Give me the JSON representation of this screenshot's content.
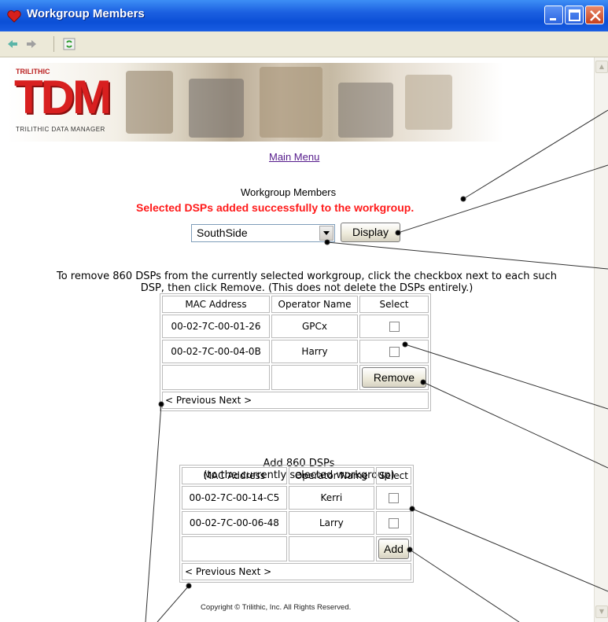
{
  "window": {
    "title": "Workgroup Members"
  },
  "logo": {
    "brand": "TRILITHIC",
    "name": "TDM",
    "subtitle": "TRILITHIC DATA MANAGER"
  },
  "nav": {
    "main_menu": "Main Menu"
  },
  "page": {
    "heading": "Workgroup Members",
    "success_message": "Selected DSPs added successfully to the workgroup."
  },
  "workgroup_select": {
    "value": "SouthSide"
  },
  "buttons": {
    "display": "Display",
    "remove": "Remove",
    "add": "Add"
  },
  "remove_section": {
    "instruction_line1": "To remove 860 DSPs from the currently selected workgroup, click the checkbox next to each such",
    "instruction_line2": "DSP, then click Remove. (This does not delete the DSPs entirely.)",
    "headers": [
      "MAC Address",
      "Operator Name",
      "Select"
    ],
    "rows": [
      {
        "mac": "00-02-7C-00-01-26",
        "operator": "GPCx"
      },
      {
        "mac": "00-02-7C-00-04-0B",
        "operator": "Harry"
      }
    ],
    "pager": "< Previous Next >"
  },
  "add_section": {
    "title_line1": "Add 860 DSPs",
    "title_line2": "(to the currently selected workgroup)",
    "headers": [
      "MAC Address",
      "Operator Name",
      "Select"
    ],
    "rows": [
      {
        "mac": "00-02-7C-00-14-C5",
        "operator": "Kerri"
      },
      {
        "mac": "00-02-7C-00-06-48",
        "operator": "Larry"
      }
    ],
    "pager": "< Previous Next >"
  },
  "footer": {
    "copyright": "Copyright © Trilithic, Inc. All Rights Reserved."
  },
  "colors": {
    "title_bar": "#0b4fd6",
    "success": "#ff1a1a",
    "logo": "#d81f1f",
    "link": "#551a8b"
  }
}
